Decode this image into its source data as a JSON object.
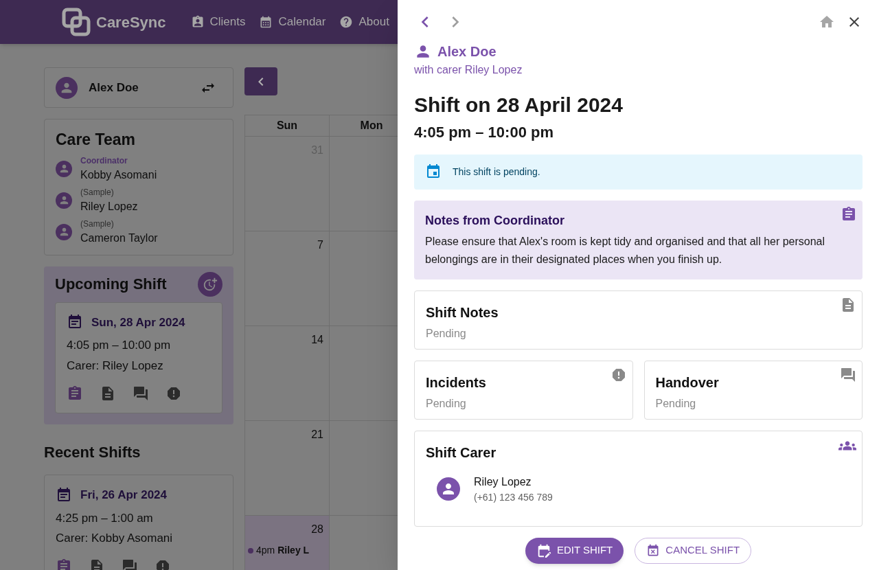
{
  "header": {
    "logo": "CareSync",
    "nav": [
      {
        "label": "Clients",
        "kind": "clients"
      },
      {
        "label": "Calendar",
        "kind": "calendar"
      },
      {
        "label": "About",
        "kind": "about"
      }
    ]
  },
  "client_selector": {
    "name": "Alex Doe"
  },
  "care_team": {
    "title": "Care Team",
    "members": [
      {
        "role": "Coordinator",
        "kind": "coordinator",
        "name": "Kobby Asomani"
      },
      {
        "role": "(Sample)",
        "kind": "sample",
        "name": "Riley Lopez"
      },
      {
        "role": "(Sample)",
        "kind": "sample",
        "name": "Cameron Taylor"
      }
    ]
  },
  "upcoming_shift": {
    "title": "Upcoming Shift",
    "date": "Sun, 28 Apr 2024",
    "time": "4:05 pm – 10:00 pm",
    "carer": "Carer: Riley Lopez"
  },
  "recent_shifts": {
    "title": "Recent Shifts",
    "shifts": [
      {
        "date": "Fri, 26 Apr 2024",
        "time": "4:25 pm – 1:00 am",
        "carer": "Carer: Kobby Asomani"
      }
    ]
  },
  "calendar": {
    "columns": [
      "Sun",
      "Mon"
    ],
    "days": [
      {
        "day": "31",
        "outside": true,
        "selected": false
      },
      {
        "day": "7",
        "outside": false,
        "selected": false
      },
      {
        "day": "14",
        "outside": false,
        "selected": false
      },
      {
        "day": "21",
        "outside": false,
        "selected": false
      },
      {
        "day": "28",
        "outside": false,
        "selected": true,
        "events": [
          {
            "time": "4pm",
            "name": "Riley L",
            "color": "#4b305f"
          }
        ]
      }
    ]
  },
  "drawer": {
    "client": {
      "name": "Alex Doe",
      "subtitle": "with carer Riley Lopez"
    },
    "title": "Shift on 28 April 2024",
    "time": "4:05 pm – 10:00 pm",
    "alert": {
      "text": "This shift is pending."
    },
    "coordinator_notes": {
      "title": "Notes from Coordinator",
      "text": "Please ensure that Alex's room is kept tidy and organised and that all her personal belongings are in their designated places when you finish up."
    },
    "shift_notes": {
      "title": "Shift Notes",
      "status": "Pending"
    },
    "reports": [
      {
        "title": "Incidents",
        "status": "Pending",
        "kind": "incidents"
      },
      {
        "title": "Handover",
        "status": "Pending",
        "kind": "handover"
      }
    ],
    "shift_carer": {
      "title": "Shift Carer",
      "name": "Riley Lopez",
      "phone": "(+61) 123 456 789"
    },
    "buttons": [
      {
        "label": "EDIT SHIFT",
        "kind": "primary"
      },
      {
        "label": "CANCEL SHIFT",
        "kind": "outlined"
      }
    ]
  }
}
